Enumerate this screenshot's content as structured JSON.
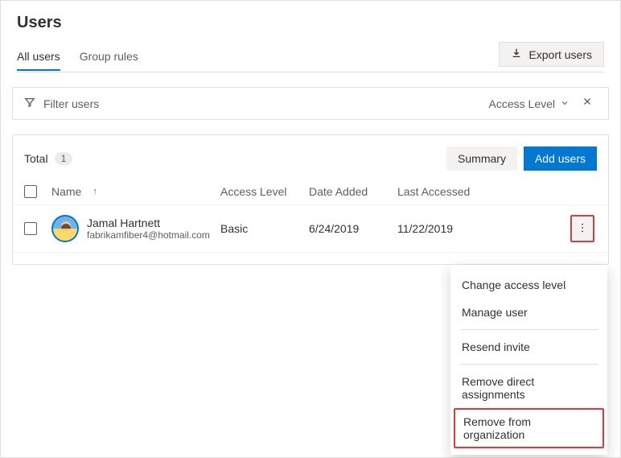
{
  "header": {
    "title": "Users",
    "export_label": "Export users",
    "tabs": [
      {
        "label": "All users",
        "active": true
      },
      {
        "label": "Group rules",
        "active": false
      }
    ]
  },
  "filter": {
    "placeholder": "Filter users",
    "level_label": "Access Level"
  },
  "toolbar": {
    "total_label": "Total",
    "total_count": "1",
    "summary_label": "Summary",
    "add_label": "Add users"
  },
  "columns": {
    "name": "Name",
    "access": "Access Level",
    "date_added": "Date Added",
    "last_accessed": "Last Accessed"
  },
  "rows": [
    {
      "name": "Jamal Hartnett",
      "email": "fabrikamfiber4@hotmail.com",
      "access": "Basic",
      "date_added": "6/24/2019",
      "last_accessed": "11/22/2019"
    }
  ],
  "context_menu": {
    "items": [
      "Change access level",
      "Manage user",
      "Resend invite",
      "Remove direct assignments",
      "Remove from organization"
    ]
  }
}
